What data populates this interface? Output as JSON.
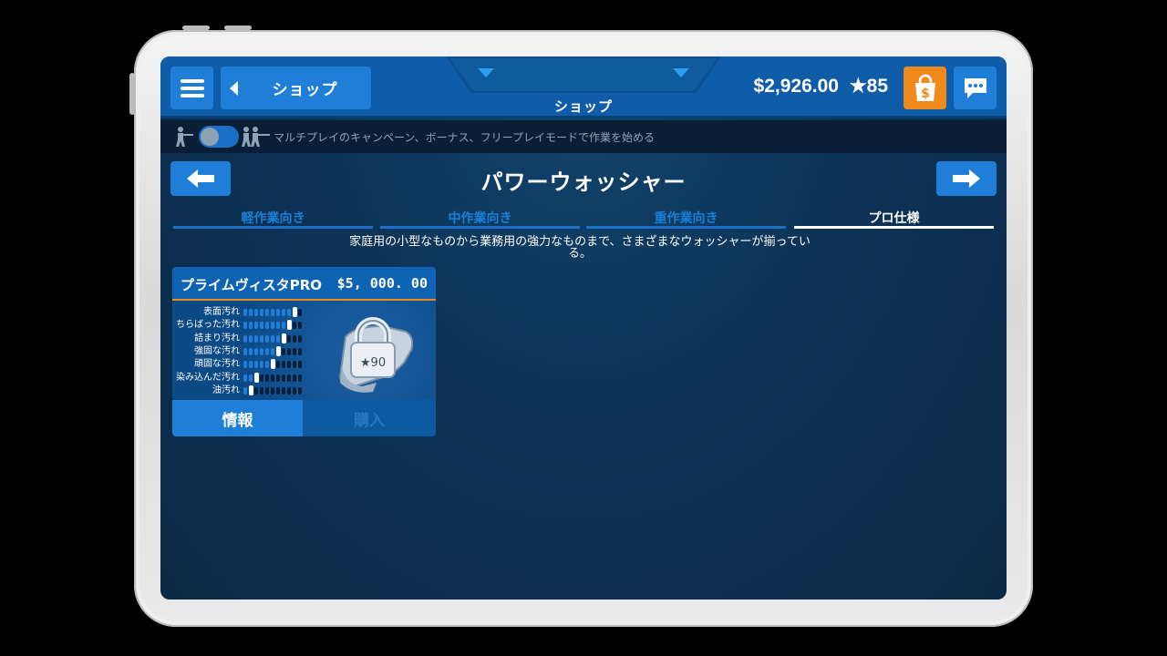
{
  "header": {
    "back_label": "ショップ",
    "center_title": "ショップ",
    "money": "$2,926.00",
    "stars": "★85"
  },
  "multiplayer": {
    "text": "マルチプレイのキャンペーン、ボーナス、フリープレイモードで作業を始める",
    "toggle_on": false
  },
  "category": {
    "title": "パワーウォッシャー",
    "tabs": [
      {
        "label": "軽作業向き",
        "active": false
      },
      {
        "label": "中作業向き",
        "active": false
      },
      {
        "label": "重作業向き",
        "active": false
      },
      {
        "label": "プロ仕様",
        "active": true
      }
    ],
    "description_line1": "家庭用の小型なものから業務用の強力なものまで、さまざまなウォッシャーが揃ってい",
    "description_line2": "る。"
  },
  "items": [
    {
      "name": "プライムヴィスタPRO",
      "price": "$5, 000. 00",
      "locked": true,
      "required_stars": "★90",
      "stats": [
        {
          "label": "表面汚れ",
          "level": 10
        },
        {
          "label": "ちらばった汚れ",
          "level": 9
        },
        {
          "label": "詰まり汚れ",
          "level": 8
        },
        {
          "label": "強固な汚れ",
          "level": 7
        },
        {
          "label": "頑固な汚れ",
          "level": 6
        },
        {
          "label": "染み込んだ汚れ",
          "level": 3
        },
        {
          "label": "油汚れ",
          "level": 2
        }
      ],
      "stat_max": 11,
      "info_label": "情報",
      "buy_label": "購入"
    }
  ],
  "colors": {
    "accent": "#1f7ed8",
    "topbar": "#0f5ca9",
    "orange": "#f08a1c",
    "background": "#0d3357"
  }
}
